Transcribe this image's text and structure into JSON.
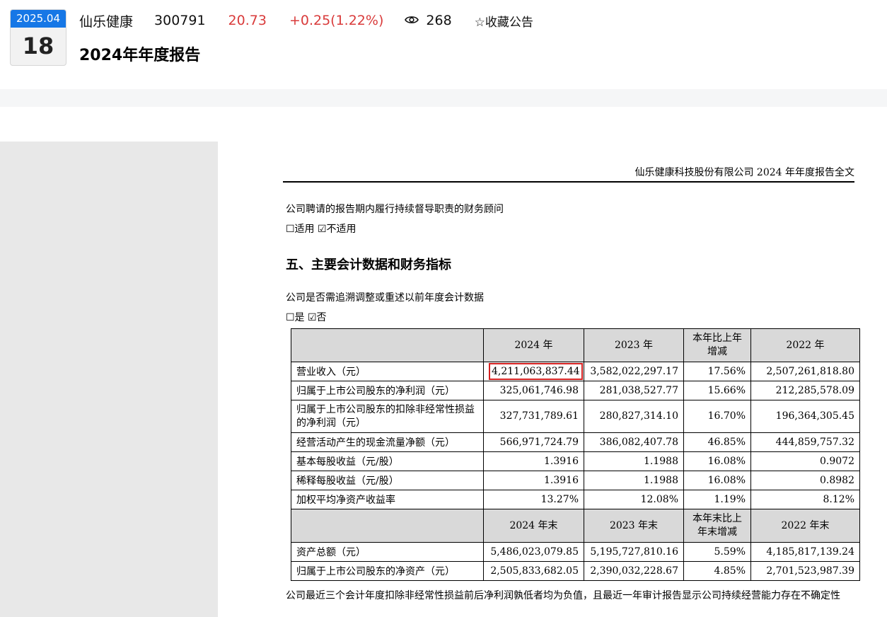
{
  "date": {
    "year_month": "2025.04",
    "day": "18"
  },
  "stock": {
    "name": "仙乐健康",
    "code": "300791",
    "price": "20.73",
    "change": "+0.25(1.22%)",
    "views": "268",
    "favorite_label": "☆收藏公告"
  },
  "doc_title": "2024年年度报告",
  "page": {
    "running_head": "仙乐健康科技股份有限公司 2024 年年度报告全文",
    "advisor_line": "公司聘请的报告期内履行持续督导职责的财务顾问",
    "advisor_options": "☐适用 ☑不适用",
    "section_title": "五、主要会计数据和财务指标",
    "restate_line": "公司是否需追溯调整或重述以前年度会计数据",
    "restate_options": "☐是 ☑否",
    "table": {
      "header1": [
        "2024 年",
        "2023 年",
        "本年比上年增减",
        "2022 年"
      ],
      "rows1": [
        [
          "营业收入（元）",
          "4,211,063,837.44",
          "3,582,022,297.17",
          "17.56%",
          "2,507,261,818.80"
        ],
        [
          "归属于上市公司股东的净利润（元）",
          "325,061,746.98",
          "281,038,527.77",
          "15.66%",
          "212,285,578.09"
        ],
        [
          "归属于上市公司股东的扣除非经常性损益的净利润（元）",
          "327,731,789.61",
          "280,827,314.10",
          "16.70%",
          "196,364,305.45"
        ],
        [
          "经营活动产生的现金流量净额（元）",
          "566,971,724.79",
          "386,082,407.78",
          "46.85%",
          "444,859,757.32"
        ],
        [
          "基本每股收益（元/股）",
          "1.3916",
          "1.1988",
          "16.08%",
          "0.9072"
        ],
        [
          "稀释每股收益（元/股）",
          "1.3916",
          "1.1988",
          "16.08%",
          "0.8982"
        ],
        [
          "加权平均净资产收益率",
          "13.27%",
          "12.08%",
          "1.19%",
          "8.12%"
        ]
      ],
      "header2": [
        "2024 年末",
        "2023 年末",
        "本年末比上年末增减",
        "2022 年末"
      ],
      "rows2": [
        [
          "资产总额（元）",
          "5,486,023,079.85",
          "5,195,727,810.16",
          "5.59%",
          "4,185,817,139.24"
        ],
        [
          "归属于上市公司股东的净资产（元）",
          "2,505,833,682.05",
          "2,390,032,228.67",
          "4.85%",
          "2,701,523,987.39"
        ]
      ]
    },
    "footer_text": "公司最近三个会计年度扣除非经常性损益前后净利润孰低者均为负值，且最近一年审计报告显示公司持续经营能力存在不确定性"
  },
  "colors": {
    "accent_blue": "#1677e6",
    "price_red": "#d93b3b",
    "highlight_red": "#d42020"
  }
}
